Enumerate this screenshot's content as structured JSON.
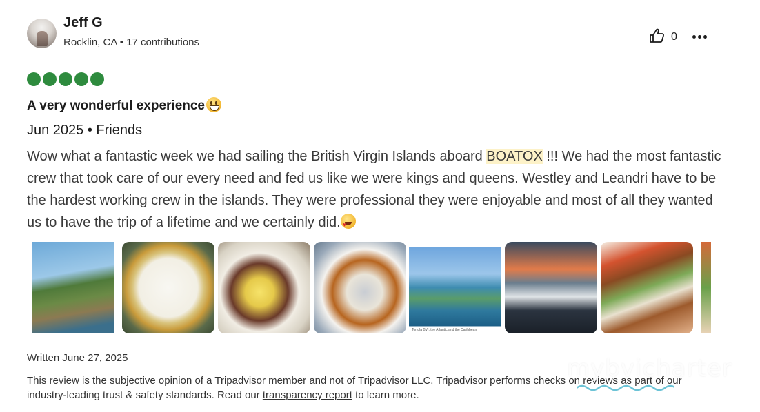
{
  "user": {
    "name": "Jeff G",
    "meta": "Rocklin, CA • 17 contributions"
  },
  "actions": {
    "helpful_count": "0"
  },
  "review": {
    "rating_bubbles": 5,
    "title": "A very wonderful experience",
    "trip_meta": "Jun 2025 • Friends",
    "body_part1": "Wow what a fantastic week we had sailing the British Virgin Islands aboard ",
    "body_highlight": "BOATOX",
    "body_part2": " !!! We had the most fantastic crew that took care of our every need and fed us like we were kings and queens. Westley and Leandri have to be the hardest working crew in the islands. They were professional they were enjoyable and most of all they wanted us to have the trip of a lifetime and we certainly did."
  },
  "photos": {
    "p5_caption": "Tortola BVI, the Atlantic and the Caribbean"
  },
  "footer": {
    "written": "Written June 27, 2025",
    "disclaimer_part1": "This review is the subjective opinion of a Tripadvisor member and not of Tripadvisor LLC. Tripadvisor performs checks on reviews as part of our industry-leading trust & safety standards. Read our ",
    "disclaimer_link": "transparency report",
    "disclaimer_part2": " to learn more."
  },
  "watermark": "mybvicharter",
  "colors": {
    "rating_green": "#2e8b3e",
    "highlight_bg": "#fdf2c8"
  }
}
